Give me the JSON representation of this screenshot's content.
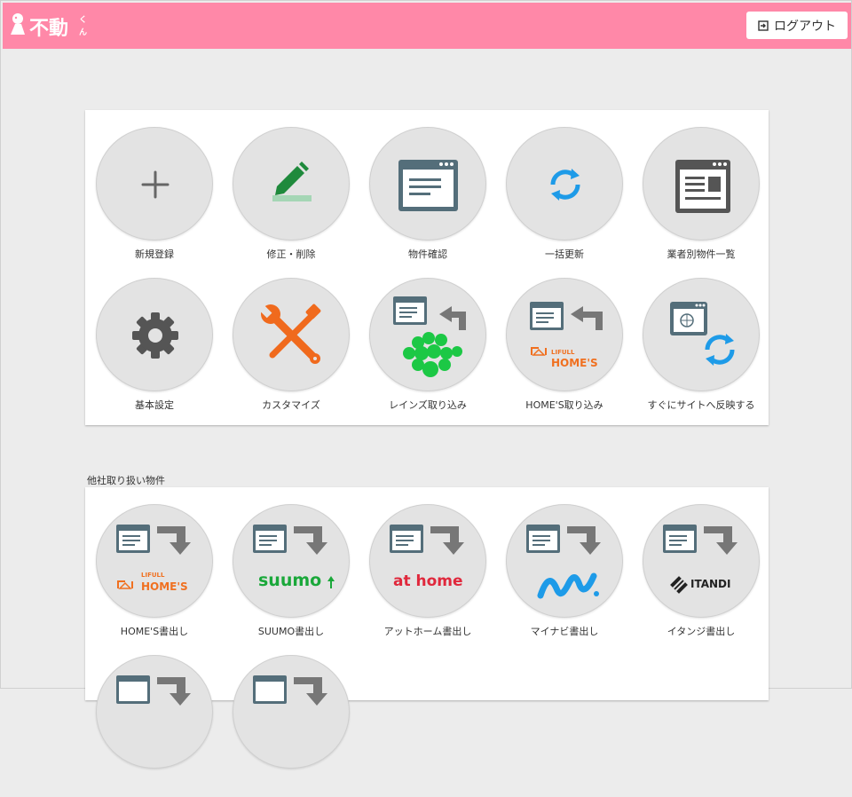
{
  "header": {
    "logo_text": "不動くん",
    "logout_label": "ログアウト",
    "logout_icon": "logout-icon",
    "background_color": "#ff88a8"
  },
  "menu": {
    "items": [
      {
        "label": "新規登録",
        "icon": "plus-icon"
      },
      {
        "label": "修正・削除",
        "icon": "edit-pencil-icon"
      },
      {
        "label": "物件確認",
        "icon": "browser-window-icon"
      },
      {
        "label": "一括更新",
        "icon": "refresh-icon"
      },
      {
        "label": "業者別物件一覧",
        "icon": "newspaper-icon"
      },
      {
        "label": "基本設定",
        "icon": "gear-icon"
      },
      {
        "label": "カスタマイズ",
        "icon": "wrench-screwdriver-icon"
      },
      {
        "label": "レインズ取り込み",
        "icon": "reins-import-icon"
      },
      {
        "label": "HOME'S取り込み",
        "icon": "homes-import-icon"
      },
      {
        "label": "すぐにサイトへ反映する",
        "icon": "site-sync-icon"
      }
    ]
  },
  "other_section": {
    "title": "他社取り扱い物件",
    "items": [
      {
        "label": "HOME'S書出し",
        "logo_line1": "LIFULL",
        "logo_line2": "HOME'S"
      },
      {
        "label": "SUUMO書出し",
        "logo_text": "suumo"
      },
      {
        "label": "アットホーム書出し",
        "logo_text": "at home"
      },
      {
        "label": "マイナビ書出し",
        "icon": "mynavi-logo-icon"
      },
      {
        "label": "イタンジ書出し",
        "logo_text": "ITANDI"
      },
      {
        "label": "",
        "icon": "export-icon"
      },
      {
        "label": "",
        "icon": "export-icon"
      }
    ]
  },
  "colors": {
    "accent_pink": "#ff88a8",
    "icon_slate": "#546e7a",
    "refresh_blue": "#1e9be8",
    "homes_orange": "#f07020",
    "suumo_green": "#1aa83a",
    "athome_red": "#e0283c",
    "mynavi_blue": "#1e9be8"
  }
}
